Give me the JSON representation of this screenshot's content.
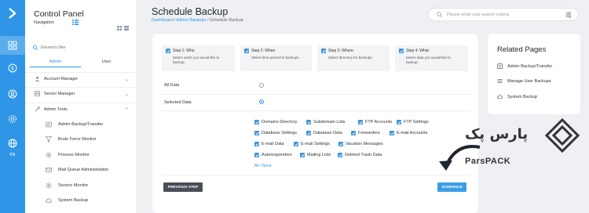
{
  "rail": {
    "lang": "EN"
  },
  "sidebar": {
    "title": "Control Panel",
    "subtitle": "Navigation",
    "search_placeholder": "Elements filter",
    "tabs": [
      "Admin",
      "User"
    ],
    "sections": [
      "Account Manager",
      "Server Manager",
      "Admin Tools"
    ],
    "items": [
      "Admin Backup/Transfer",
      "Brute Force Monitor",
      "Process Monitor",
      "Mail Queue Administration",
      "Service Monitor",
      "System Backup"
    ]
  },
  "header": {
    "title": "Schedule Backup",
    "breadcrumb": {
      "dashboard": "Dashboard",
      "sep1": " / ",
      "admin_backups": "Admin Backups",
      "sep2": " / ",
      "current": "Schedule Backup"
    },
    "search_placeholder": "Please enter your search criteria"
  },
  "steps": [
    {
      "title": "Step 1: Who",
      "desc": "Select users you would like to backup."
    },
    {
      "title": "Step 2: When",
      "desc": "Select time period for backups."
    },
    {
      "title": "Step 3: Where",
      "desc": "Select directory for backups."
    },
    {
      "title": "Step 4: What",
      "desc": "Select data you would like to backup."
    }
  ],
  "data_choice": {
    "all_data": "All Data",
    "selected_data": "Selected Data",
    "selected": "Selected Data"
  },
  "options": [
    [
      "Domains Directory",
      "Subdomain Lists",
      "FTP Accounts",
      "FTP Settings"
    ],
    [
      "Database Settings",
      "Database Data",
      "Forwarders",
      "E-mail Accounts"
    ],
    [
      "E-mail Data",
      "E-mail Settings",
      "Vacation Messages"
    ],
    [
      "Autoresponders",
      "Mailing Lists",
      "Deleted Trash Data"
    ]
  ],
  "select_links": {
    "all": "All",
    "sep": " / ",
    "none": "None"
  },
  "buttons": {
    "prev": "PREVIOUS STEP",
    "schedule": "SCHEDULE"
  },
  "related": {
    "title": "Related Pages",
    "items": [
      "Admin Backup/Transfer",
      "Manage User Backups",
      "System Backup"
    ]
  },
  "watermark": {
    "fa": "پارس پک",
    "en": "ParsPACK"
  },
  "colors": {
    "accent": "#2f95e6",
    "rail": "#2f95e6",
    "prev_button": "#4a4f57"
  }
}
